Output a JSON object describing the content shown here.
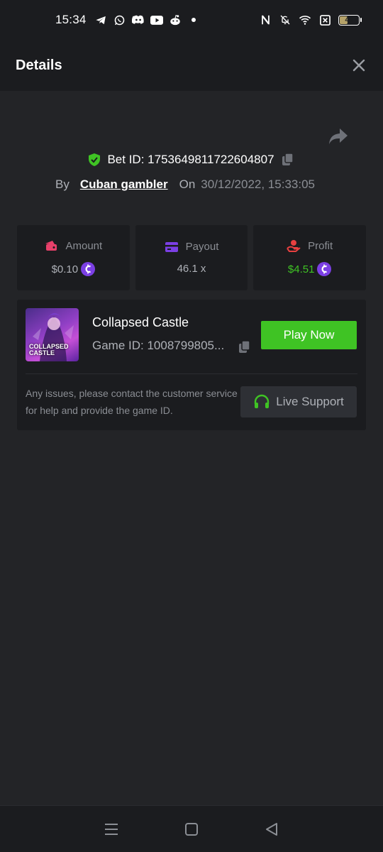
{
  "status_bar": {
    "time": "15:34",
    "left_icons": [
      "telegram-icon",
      "whatsapp-icon",
      "discord-icon",
      "youtube-icon",
      "reddit-icon",
      "dot-icon"
    ],
    "right_icons": [
      "nfc-icon",
      "bell-off-icon",
      "wifi-icon",
      "sim-off-icon"
    ],
    "battery": "46",
    "battery_level": 0.46
  },
  "header": {
    "title": "Details"
  },
  "bet": {
    "bet_id_text": "Bet ID: 1753649811722604807",
    "by_label": "By",
    "username": "Cuban gambler",
    "on_label": "On",
    "date": "30/12/2022, 15:33:05"
  },
  "stats": {
    "amount_label": "Amount",
    "amount_value": "$0.10",
    "payout_label": "Payout",
    "payout_value": "46.1 x",
    "profit_label": "Profit",
    "profit_value": "$4.51"
  },
  "game": {
    "name": "Collapsed Castle",
    "id_text": "Game ID: 1008799805...",
    "thumb_line1": "COLLAPSED",
    "thumb_line2": "CASTLE",
    "play_label": "Play Now",
    "issue_text": "Any issues, please contact the customer service for help and provide the game ID.",
    "support_label": "Live Support"
  },
  "colors": {
    "background": "#232427",
    "panel": "#1b1c1f",
    "accent_green": "#3fc324",
    "coin_purple": "#7b3fe4",
    "amount_icon": "#e8406a",
    "payout_icon": "#7b3fe4",
    "profit_icon": "#e84040"
  }
}
